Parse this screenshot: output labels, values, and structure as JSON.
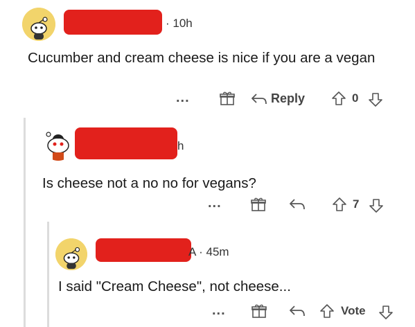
{
  "comments": [
    {
      "timestamp": "10h",
      "text": "Cucumber and cream cheese is nice if you are a vegan",
      "actions": {
        "more": "...",
        "reply_label": "Reply",
        "vote_count": "0"
      }
    },
    {
      "timestamp": "h",
      "text": "Is cheese not a no no for vegans?",
      "actions": {
        "more": "...",
        "vote_count": "7"
      }
    },
    {
      "username_tail": "A",
      "timestamp": "45m",
      "text": "I said \"Cream Cheese\", not cheese...",
      "actions": {
        "more": "...",
        "vote_label": "Vote"
      }
    }
  ],
  "colors": {
    "redaction": "#e2211c",
    "avatar_bg": "#f2d46b",
    "thread_line": "#dcdcdc"
  },
  "icons": [
    "snoo-avatar",
    "gift-icon",
    "reply-arrow-icon",
    "upvote-icon",
    "downvote-icon"
  ]
}
